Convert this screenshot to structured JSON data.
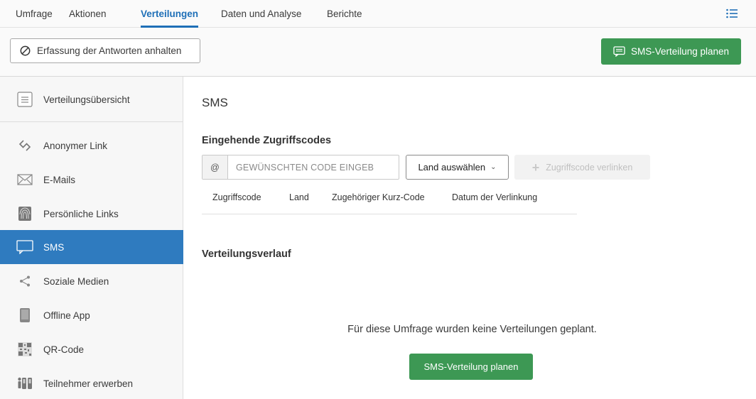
{
  "topnav": {
    "tabs": [
      {
        "label": "Umfrage"
      },
      {
        "label": "Aktionen"
      },
      {
        "label": "Verteilungen",
        "active": true
      },
      {
        "label": "Daten und Analyse"
      },
      {
        "label": "Berichte"
      }
    ],
    "menu_icon": "list-icon"
  },
  "toolbar": {
    "stop_label": "Erfassung der Antworten anhalten",
    "plan_label": "SMS-Verteilung planen"
  },
  "sidebar": {
    "items": [
      {
        "label": "Verteilungsübersicht",
        "icon": "overview-icon"
      },
      {
        "label": "Anonymer Link",
        "icon": "link-icon"
      },
      {
        "label": "E-Mails",
        "icon": "envelope-icon"
      },
      {
        "label": "Persönliche Links",
        "icon": "fingerprint-icon"
      },
      {
        "label": "SMS",
        "icon": "chat-bubble-icon",
        "active": true
      },
      {
        "label": "Soziale Medien",
        "icon": "share-icon"
      },
      {
        "label": "Offline App",
        "icon": "tablet-icon"
      },
      {
        "label": "QR-Code",
        "icon": "qr-code-icon"
      },
      {
        "label": "Teilnehmer erwerben",
        "icon": "people-icon"
      }
    ]
  },
  "main": {
    "title": "SMS",
    "incoming_heading": "Eingehende Zugriffscodes",
    "code_prefix": "@",
    "code_placeholder": "GEWÜNSCHTEN CODE EINGEB",
    "country_label": "Land auswählen",
    "link_button_label": "Zugriffscode verlinken",
    "columns": [
      "Zugriffscode",
      "Land",
      "Zugehöriger Kurz-Code",
      "Datum der Verlinkung"
    ],
    "history_heading": "Verteilungsverlauf",
    "empty_message": "Für diese Umfrage wurden keine Verteilungen geplant.",
    "plan_button_label": "SMS-Verteilung planen"
  },
  "colors": {
    "accent_blue": "#2f7bbf",
    "green": "#3d9854"
  }
}
